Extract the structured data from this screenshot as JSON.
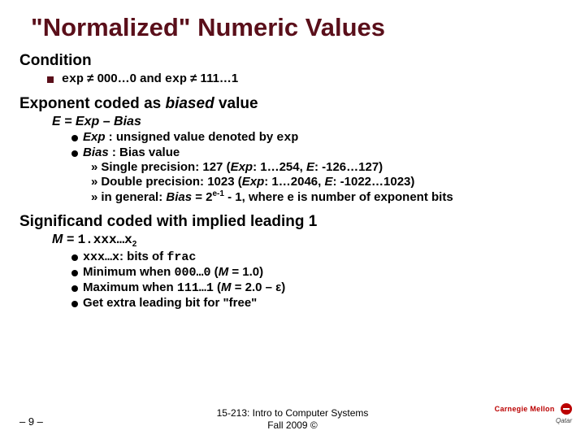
{
  "title": "\"Normalized\" Numeric Values",
  "s1": {
    "head": "Condition",
    "line": {
      "pre": "exp",
      "mid": " ≠ 000…0 and ",
      "code2": "exp",
      "post": " ≠ 111…1"
    }
  },
  "s2": {
    "head_a": "Exponent coded as ",
    "head_b": "biased",
    "head_c": " value",
    "eq": "E  =  Exp – Bias",
    "b1a": "Exp",
    "b1b": " : unsigned value denoted by ",
    "b1c": "exp",
    "b2a": "Bias",
    "b2b": " : Bias value",
    "sp_a": "Single precision: 127 (",
    "sp_b": "Exp",
    "sp_c": ": 1…254, ",
    "sp_d": "E",
    "sp_e": ": -126…127)",
    "dp_a": "Double precision: 1023 (",
    "dp_b": "Exp",
    "dp_c": ": 1…2046, ",
    "dp_d": "E",
    "dp_e": ": -1022…1023)",
    "g_a": "in general: ",
    "g_b": "Bias",
    "g_c": " = 2",
    "g_sup": "e-1",
    "g_d": " - 1, where e is number of exponent bits"
  },
  "s3": {
    "head": "Significand coded with implied leading 1",
    "eq_a": "M  =  ",
    "eq_b": "1.xxx…x",
    "eq_sub": "2",
    "l1a": "xxx…x",
    "l1b": ": bits of ",
    "l1c": "frac",
    "l2a": "Minimum when ",
    "l2b": "000…0",
    "l2c": " (",
    "l2d": "M",
    "l2e": " = 1.0)",
    "l3a": "Maximum when ",
    "l3b": "111…1",
    "l3c": " (",
    "l3d": "M",
    "l3e": " = 2.0 – ε)",
    "l4": "Get extra leading bit for \"free\""
  },
  "footer": {
    "page": "– 9 –",
    "course": "15-213: Intro to Computer Systems",
    "term": "Fall 2009 ©",
    "logo1": "Carnegie Mellon",
    "logo2": "Qatar"
  }
}
